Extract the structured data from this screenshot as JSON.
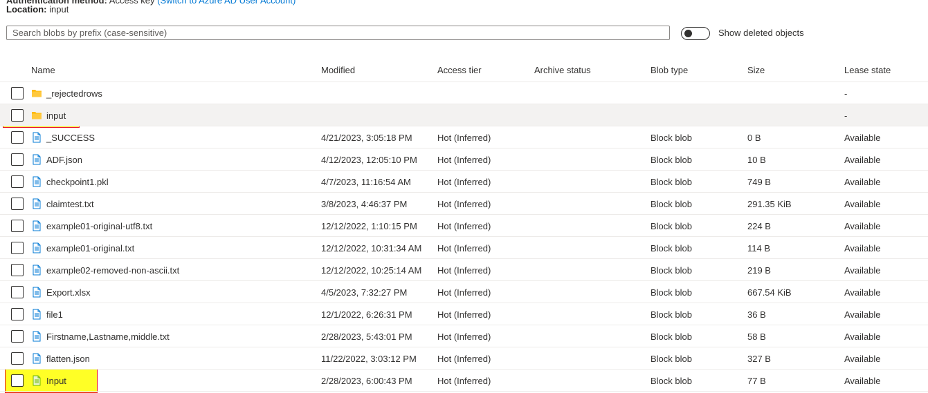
{
  "auth": {
    "label": "Authentication method:",
    "value": "Access key",
    "link": "(Switch to Azure AD User Account)"
  },
  "location": {
    "label": "Location:",
    "value": "input"
  },
  "search": {
    "placeholder": "Search blobs by prefix (case-sensitive)",
    "value": ""
  },
  "show_deleted": {
    "label": "Show deleted objects",
    "on": false
  },
  "columns": [
    "Name",
    "Modified",
    "Access tier",
    "Archive status",
    "Blob type",
    "Size",
    "Lease state"
  ],
  "rows": [
    {
      "kind": "folder",
      "name": "_rejectedrows",
      "modified": "",
      "tier": "",
      "archive": "",
      "type": "",
      "size": "",
      "lease": "-"
    },
    {
      "kind": "folder",
      "name": "input",
      "modified": "",
      "tier": "",
      "archive": "",
      "type": "",
      "size": "",
      "lease": "-"
    },
    {
      "kind": "file",
      "name": "_SUCCESS",
      "modified": "4/21/2023, 3:05:18 PM",
      "tier": "Hot (Inferred)",
      "archive": "",
      "type": "Block blob",
      "size": "0 B",
      "lease": "Available"
    },
    {
      "kind": "file",
      "name": "ADF.json",
      "modified": "4/12/2023, 12:05:10 PM",
      "tier": "Hot (Inferred)",
      "archive": "",
      "type": "Block blob",
      "size": "10 B",
      "lease": "Available"
    },
    {
      "kind": "file",
      "name": "checkpoint1.pkl",
      "modified": "4/7/2023, 11:16:54 AM",
      "tier": "Hot (Inferred)",
      "archive": "",
      "type": "Block blob",
      "size": "749 B",
      "lease": "Available"
    },
    {
      "kind": "file",
      "name": "claimtest.txt",
      "modified": "3/8/2023, 4:46:37 PM",
      "tier": "Hot (Inferred)",
      "archive": "",
      "type": "Block blob",
      "size": "291.35 KiB",
      "lease": "Available"
    },
    {
      "kind": "file",
      "name": "example01-original-utf8.txt",
      "modified": "12/12/2022, 1:10:15 PM",
      "tier": "Hot (Inferred)",
      "archive": "",
      "type": "Block blob",
      "size": "224 B",
      "lease": "Available"
    },
    {
      "kind": "file",
      "name": "example01-original.txt",
      "modified": "12/12/2022, 10:31:34 AM",
      "tier": "Hot (Inferred)",
      "archive": "",
      "type": "Block blob",
      "size": "114 B",
      "lease": "Available"
    },
    {
      "kind": "file",
      "name": "example02-removed-non-ascii.txt",
      "modified": "12/12/2022, 10:25:14 AM",
      "tier": "Hot (Inferred)",
      "archive": "",
      "type": "Block blob",
      "size": "219 B",
      "lease": "Available"
    },
    {
      "kind": "file",
      "name": "Export.xlsx",
      "modified": "4/5/2023, 7:32:27 PM",
      "tier": "Hot (Inferred)",
      "archive": "",
      "type": "Block blob",
      "size": "667.54 KiB",
      "lease": "Available"
    },
    {
      "kind": "file",
      "name": "file1",
      "modified": "12/1/2022, 6:26:31 PM",
      "tier": "Hot (Inferred)",
      "archive": "",
      "type": "Block blob",
      "size": "36 B",
      "lease": "Available"
    },
    {
      "kind": "file",
      "name": "Firstname,Lastname,middle.txt",
      "modified": "2/28/2023, 5:43:01 PM",
      "tier": "Hot (Inferred)",
      "archive": "",
      "type": "Block blob",
      "size": "58 B",
      "lease": "Available"
    },
    {
      "kind": "file",
      "name": "flatten.json",
      "modified": "11/22/2022, 3:03:12 PM",
      "tier": "Hot (Inferred)",
      "archive": "",
      "type": "Block blob",
      "size": "327 B",
      "lease": "Available"
    },
    {
      "kind": "file-green",
      "name": "Input",
      "modified": "2/28/2023, 6:00:43 PM",
      "tier": "Hot (Inferred)",
      "archive": "",
      "type": "Block blob",
      "size": "77 B",
      "lease": "Available"
    }
  ],
  "colors": {
    "folder": "#ffb900",
    "file": "#0078d4",
    "highlight": "#ffff00",
    "highlight_border": "#e81123"
  }
}
